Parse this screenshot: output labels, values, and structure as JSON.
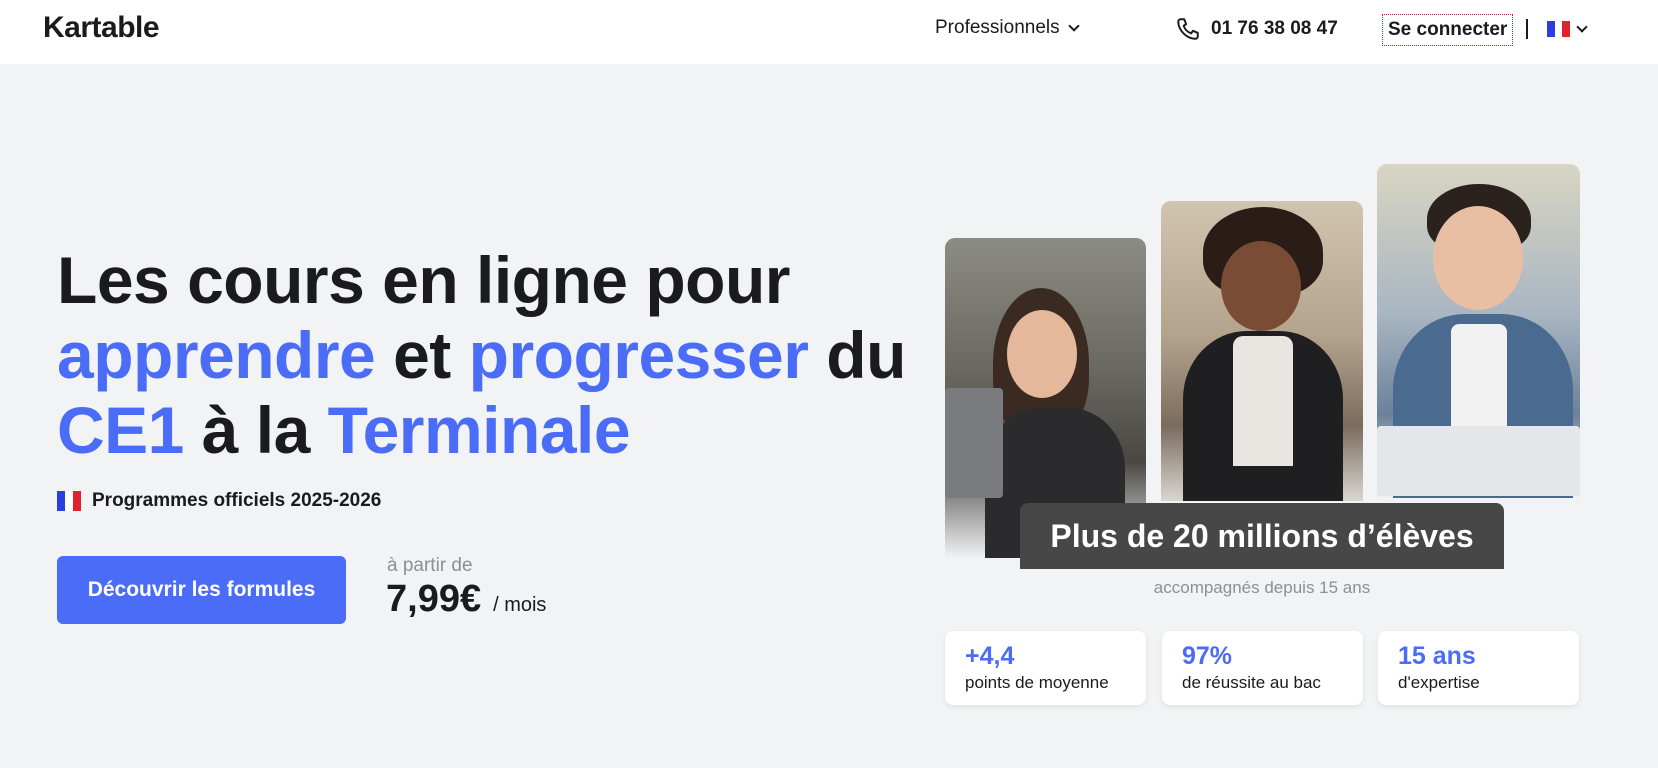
{
  "header": {
    "logo": "Kartable",
    "nav_professionnels": "Professionnels",
    "phone": "01 76 38 08 47",
    "login": "Se connecter",
    "language_icon": "french-flag-icon"
  },
  "hero": {
    "title_line1": "Les cours en ligne pour",
    "title_w_apprendre": "apprendre",
    "title_w_et": "et",
    "title_w_progresser": "progresser",
    "title_w_du": "du",
    "title_w_ce1": "CE1",
    "title_w_ala": "à la",
    "title_w_terminale": "Terminale",
    "programmes": "Programmes officiels 2025-2026",
    "cta": "Découvrir les formules",
    "price_from": "à partir de",
    "price_amount": "7,99€",
    "price_period": "/ mois"
  },
  "social_proof": {
    "banner": "Plus de 20 millions d’élèves",
    "banner_sub": "accompagnés depuis 15 ans"
  },
  "stats": [
    {
      "value": "+4,4",
      "label": "points de moyenne"
    },
    {
      "value": "97%",
      "label": "de réussite au bac"
    },
    {
      "value": "15 ans",
      "label": "d'expertise"
    }
  ],
  "colors": {
    "accent": "#4a6cf7",
    "background": "#f2f3f5",
    "text": "#1b1b1f",
    "banner": "#474747"
  }
}
